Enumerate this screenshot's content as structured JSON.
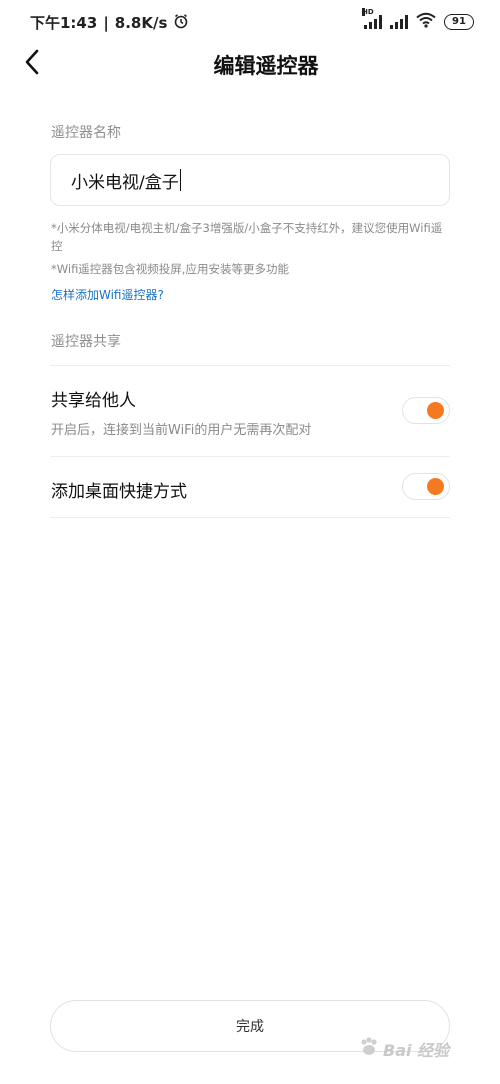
{
  "status_bar": {
    "time": "下午1:43",
    "separator": "|",
    "net_speed": "8.8K/s",
    "signal_hd": "HD",
    "battery": "91"
  },
  "header": {
    "title": "编辑遥控器"
  },
  "name_section": {
    "label": "遥控器名称",
    "input_value": "小米电视/盒子"
  },
  "notes": {
    "note1": "*小米分体电视/电视主机/盒子3增强版/小盒子不支持红外，建议您使用Wifi遥控",
    "note2": "*Wifi遥控器包含视频投屏,应用安装等更多功能",
    "help_link": "怎样添加Wifi遥控器?"
  },
  "share_section": {
    "label": "遥控器共享",
    "share_title": "共享给他人",
    "share_subtitle": "开启后，连接到当前WiFi的用户无需再次配对",
    "share_on": true,
    "shortcut_title": "添加桌面快捷方式",
    "shortcut_on": true
  },
  "footer": {
    "done_label": "完成"
  },
  "watermark": {
    "text": "Bai 经验"
  },
  "colors": {
    "accent": "#f57a1f",
    "link": "#1a73c8"
  }
}
